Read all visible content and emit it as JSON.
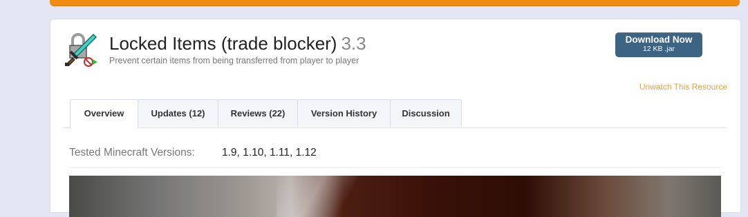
{
  "resource": {
    "title": "Locked Items (trade blocker)",
    "version": "3.3",
    "tagline": "Prevent certain items from being transferred from player to player",
    "icon": "locked-sword-icon"
  },
  "download": {
    "label": "Download Now",
    "size": "12 KB .jar"
  },
  "watch": {
    "label": "Unwatch This Resource"
  },
  "tabs": [
    {
      "label": "Overview",
      "active": true
    },
    {
      "label": "Updates (12)"
    },
    {
      "label": "Reviews (22)"
    },
    {
      "label": "Version History"
    },
    {
      "label": "Discussion"
    }
  ],
  "tested": {
    "label": "Tested Minecraft Versions:",
    "value": "1.9, 1.10, 1.11, 1.12"
  },
  "colors": {
    "banner": "#f28b12",
    "download_bg": "#3e6483",
    "unwatch": "#e3a046"
  }
}
